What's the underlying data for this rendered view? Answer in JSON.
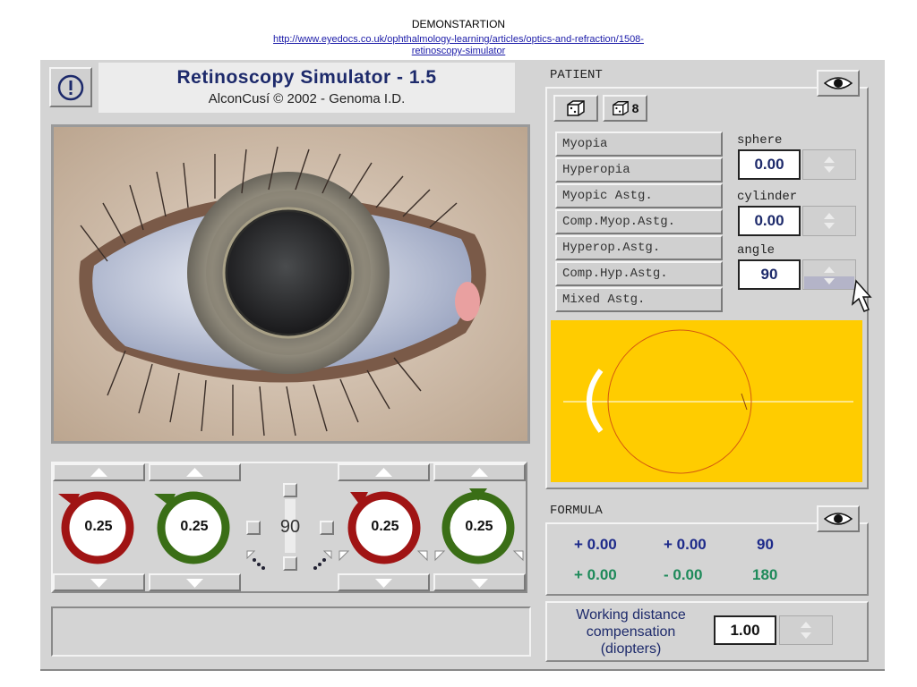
{
  "header": {
    "title": "DEMONSTARTION",
    "url_line1": "http://www.eyedocs.co.uk/ophthalmology-learning/articles/optics-and-refraction/1508-",
    "url_line2": "retinoscopy-simulator"
  },
  "app": {
    "title": "Retinoscopy Simulator - 1.5",
    "subtitle": "AlconCusí © 2002 - Genoma I.D.",
    "info_icon": "exclamation-circle-icon"
  },
  "patient": {
    "label": "PATIENT",
    "dice_button_1_icon": "dice-icon",
    "dice_button_2_label": "8",
    "diagnoses": [
      "Myopia",
      "Hyperopia",
      "Myopic Astg.",
      "Comp.Myop.Astg.",
      "Hyperop.Astg.",
      "Comp.Hyp.Astg.",
      "Mixed Astg."
    ],
    "sphere_label": "sphere",
    "sphere_value": "0.00",
    "cylinder_label": "cylinder",
    "cylinder_value": "0.00",
    "angle_label": "angle",
    "angle_value": "90",
    "diagram_bg": "#ffcc00"
  },
  "controls": {
    "lens1_value": "0.25",
    "lens2_value": "0.25",
    "axis_value": "90",
    "lens3_value": "0.25",
    "lens4_value": "0.25",
    "red": "#a01414",
    "green": "#3a6e16"
  },
  "formula": {
    "label": "FORMULA",
    "row1": [
      "+ 0.00",
      "+ 0.00",
      "90"
    ],
    "row2": [
      "+ 0.00",
      "- 0.00",
      "180"
    ],
    "row1_color": "#1d2a8a",
    "row2_color": "#1e8a5a"
  },
  "working_distance": {
    "label": "Working distance compensation (diopters)",
    "value": "1.00"
  }
}
